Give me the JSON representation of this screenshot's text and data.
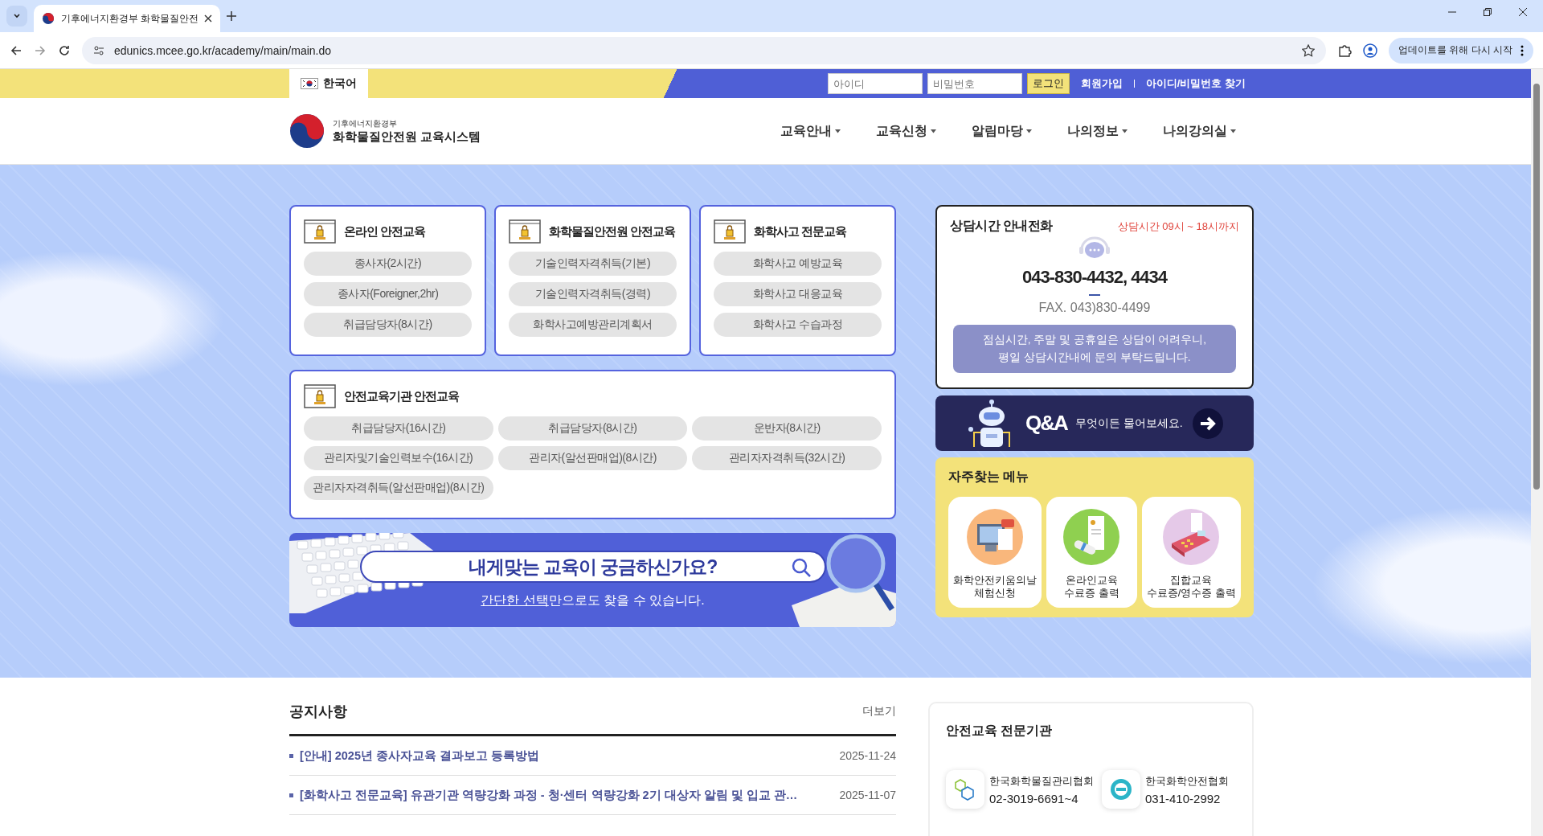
{
  "browser": {
    "tab_title": "기후에너지환경부 화학물질안전",
    "url": "edunics.mcee.go.kr/academy/main/main.do",
    "update_button": "업데이트를 위해 다시 시작"
  },
  "topbar": {
    "language": "한국어",
    "id_placeholder": "아이디",
    "pw_placeholder": "비밀번호",
    "login": "로그인",
    "links": [
      "회원가입",
      "아이디/비밀번호 찾기"
    ]
  },
  "header": {
    "org": "기후에너지환경부",
    "title": "화학물질안전원 교육시스템",
    "nav": [
      "교육안내",
      "교육신청",
      "알림마당",
      "나의정보",
      "나의강의실"
    ]
  },
  "course_groups": [
    {
      "title": "온라인 안전교육",
      "items": [
        "종사자(2시간)",
        "종사자(Foreigner,2hr)",
        "취급담당자(8시간)"
      ]
    },
    {
      "title": "화학물질안전원 안전교육",
      "items": [
        "기술인력자격취득(기본)",
        "기술인력자격취득(경력)",
        "화학사고예방관리계획서"
      ]
    },
    {
      "title": "화학사고 전문교육",
      "items": [
        "화학사고 예방교육",
        "화학사고 대응교육",
        "화학사고 수습과정"
      ]
    },
    {
      "title": "안전교육기관 안전교육",
      "items": [
        "취급담당자(16시간)",
        "취급담당자(8시간)",
        "운반자(8시간)",
        "관리자및기술인력보수(16시간)",
        "관리자(알선판매업)(8시간)",
        "관리자자격취득(32시간)",
        "관리자자격취득(알선판매업)(8시간)"
      ]
    }
  ],
  "search_banner": {
    "title": "내게맞는 교육이 궁금하신가요?",
    "subtitle_link": "간단한 선택",
    "subtitle_rest": "만으로도 찾을 수 있습니다."
  },
  "consult": {
    "title": "상담시간 안내전화",
    "hours": "상담시간 09시 ~ 18시까지",
    "phone": "043-830-4432, 4434",
    "fax": "FAX. 043)830-4499",
    "notice_lines": [
      "점심시간, 주말 및 공휴일은 상담이 어려우니,",
      "평일 상담시간내에 문의 부탁드립니다."
    ]
  },
  "qna": {
    "title": "Q&A",
    "text": "무엇이든 물어보세요."
  },
  "quick_menu": {
    "title": "자주찾는 메뉴",
    "items": [
      {
        "kind": "computer",
        "lines": [
          "화학안전키움의날",
          "체험신청"
        ]
      },
      {
        "kind": "certificate",
        "lines": [
          "온라인교육",
          "수료증 출력"
        ]
      },
      {
        "kind": "terminal",
        "lines": [
          "집합교육",
          "수료증/영수증 출력"
        ]
      }
    ]
  },
  "notices": {
    "title": "공지사항",
    "more": "더보기",
    "items": [
      {
        "title": "[안내] 2025년 종사자교육 결과보고 등록방법",
        "date": "2025-11-24"
      },
      {
        "title": "[화학사고 전문교육] 유관기관 역량강화 과정 - 청·센터 역량강화 2기 대상자 알림 및 입교 관…",
        "date": "2025-11-07"
      }
    ]
  },
  "agencies": {
    "title": "안전교육 전문기관",
    "items": [
      {
        "kind": "hexagon",
        "name": "한국화학물질관리협회",
        "phone": "02-3019-6691~4"
      },
      {
        "kind": "circle",
        "name": "한국화학안전협회",
        "phone": "031-410-2992"
      }
    ]
  }
}
